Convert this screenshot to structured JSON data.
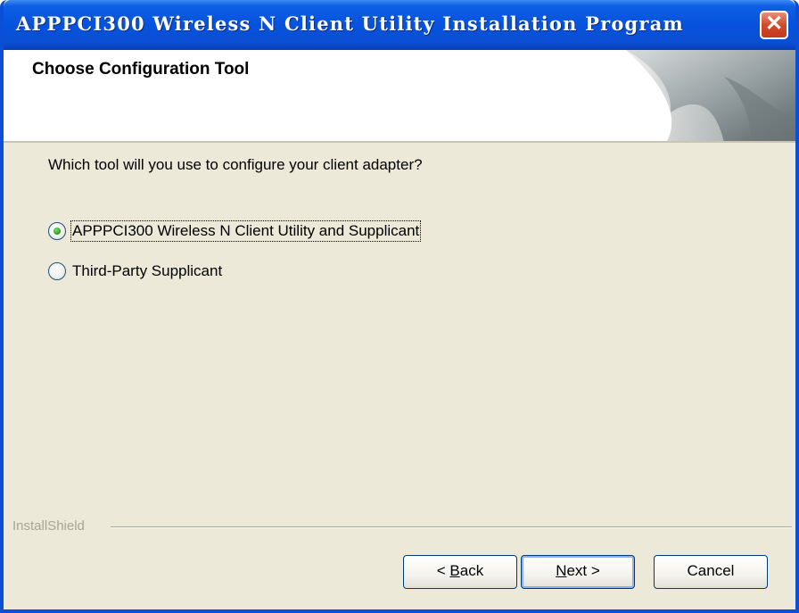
{
  "window": {
    "title": "APPPCI300 Wireless N Client Utility Installation Program",
    "close_symbol": "✕"
  },
  "header": {
    "title": "Choose Configuration Tool"
  },
  "main": {
    "question": "Which tool will you use to configure your client adapter?",
    "options": [
      {
        "label": "APPPCI300 Wireless N Client Utility and Supplicant",
        "selected": true
      },
      {
        "label": "Third-Party Supplicant",
        "selected": false
      }
    ]
  },
  "footer": {
    "brand": "InstallShield",
    "back_prefix": "< ",
    "back_accel": "B",
    "back_rest": "ack",
    "next_accel": "N",
    "next_rest": "ext >",
    "cancel_label": "Cancel"
  },
  "colors": {
    "titlebar": "#0652dd",
    "dialog_background": "#ece9d8",
    "close_button": "#d2492a",
    "radio_selected": "#2b9a1c"
  }
}
